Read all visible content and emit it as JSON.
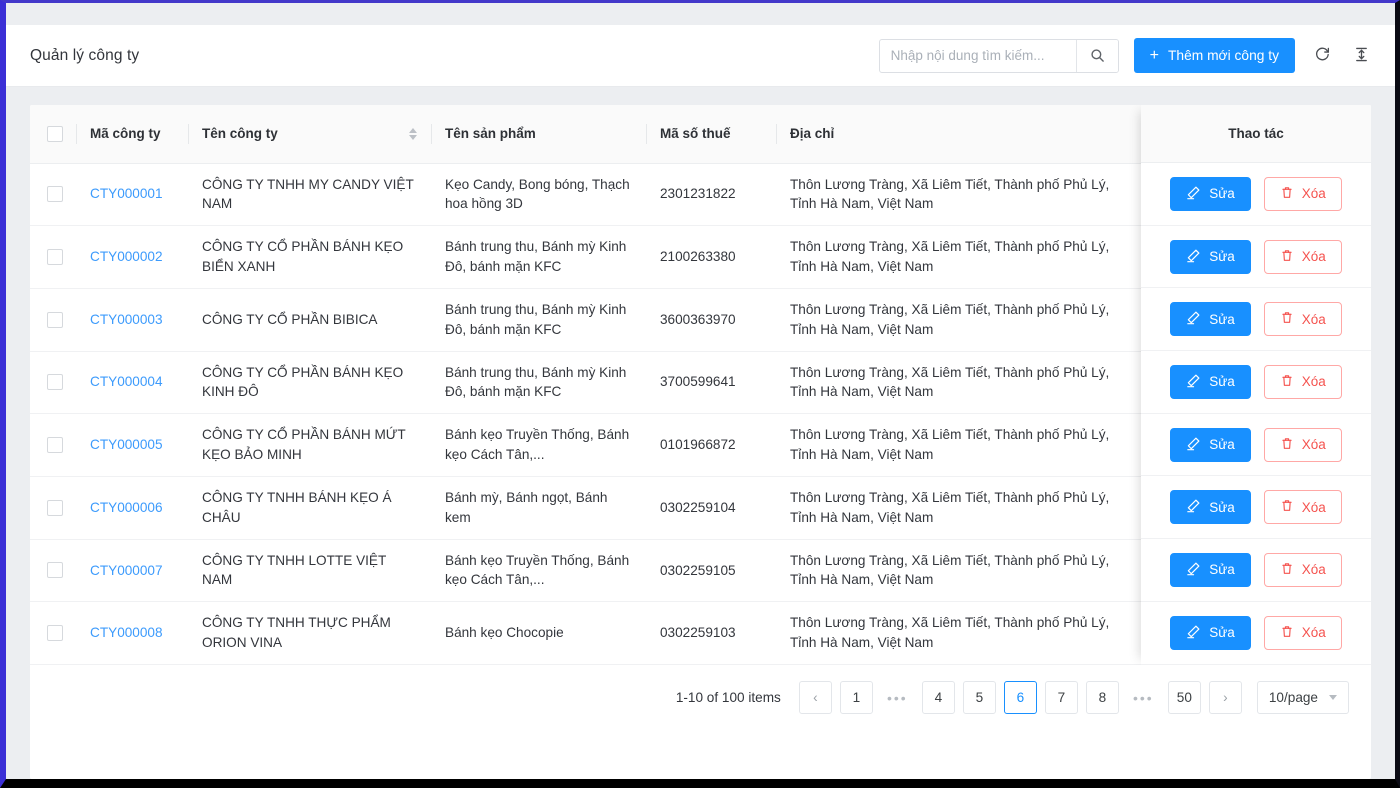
{
  "header": {
    "title": "Quản lý công ty",
    "search_placeholder": "Nhập nội dung tìm kiếm...",
    "search_value": "",
    "add_button": "Thêm mới công ty",
    "add_button_plus": "+",
    "reload_icon": "reload-icon",
    "column_height_icon": "column-height-icon",
    "search_icon": "search-icon",
    "accent_color": "#1890ff"
  },
  "table": {
    "columns": [
      {
        "key": "checkbox",
        "label": ""
      },
      {
        "key": "code",
        "label": "Mã công ty"
      },
      {
        "key": "name",
        "label": "Tên công ty",
        "sortable": true
      },
      {
        "key": "product",
        "label": "Tên sản phẩm"
      },
      {
        "key": "tax",
        "label": "Mã số thuế"
      },
      {
        "key": "address",
        "label": "Địa chỉ"
      }
    ],
    "action_column_label": "Thao tác",
    "edit_label": "Sửa",
    "delete_label": "Xóa",
    "edit_icon": "pencil-icon",
    "delete_icon": "trash-icon",
    "rows": [
      {
        "code": "CTY000001",
        "name": "CÔNG TY TNHH MY CANDY VIỆT NAM",
        "product": "Kẹo Candy, Bong bóng, Thạch hoa hồng 3D",
        "tax": "2301231822",
        "address": "Thôn Lương Tràng, Xã Liêm Tiết, Thành phố Phủ Lý, Tỉnh Hà Nam, Việt Nam"
      },
      {
        "code": "CTY000002",
        "name": "CÔNG TY CỔ PHẦN BÁNH KẸO BIỂN XANH",
        "product": "Bánh trung thu, Bánh mỳ Kinh Đô, bánh mặn KFC",
        "tax": "2100263380",
        "address": "Thôn Lương Tràng, Xã Liêm Tiết, Thành phố Phủ Lý, Tỉnh Hà Nam, Việt Nam"
      },
      {
        "code": "CTY000003",
        "name": "CÔNG TY CỔ PHẦN BIBICA",
        "product": "Bánh trung thu, Bánh mỳ Kinh Đô, bánh mặn KFC",
        "tax": "3600363970",
        "address": "Thôn Lương Tràng, Xã Liêm Tiết, Thành phố Phủ Lý, Tỉnh Hà Nam, Việt Nam"
      },
      {
        "code": "CTY000004",
        "name": "CÔNG TY CỔ PHẦN BÁNH KẸO KINH ĐÔ",
        "product": "Bánh trung thu, Bánh mỳ Kinh Đô, bánh mặn KFC",
        "tax": "3700599641",
        "address": "Thôn Lương Tràng, Xã Liêm Tiết, Thành phố Phủ Lý, Tỉnh Hà Nam, Việt Nam"
      },
      {
        "code": "CTY000005",
        "name": "CÔNG TY CỔ PHẦN BÁNH MỨT KẸO BẢO MINH",
        "product": "Bánh kẹo Truyền Thống, Bánh kẹo Cách Tân,...",
        "tax": "0101966872",
        "address": "Thôn Lương Tràng, Xã Liêm Tiết, Thành phố Phủ Lý, Tỉnh Hà Nam, Việt Nam"
      },
      {
        "code": "CTY000006",
        "name": "CÔNG TY TNHH BÁNH KẸO Á CHÂU",
        "product": "Bánh mỳ, Bánh ngọt, Bánh kem",
        "tax": "0302259104",
        "address": "Thôn Lương Tràng, Xã Liêm Tiết, Thành phố Phủ Lý, Tỉnh Hà Nam, Việt Nam"
      },
      {
        "code": "CTY000007",
        "name": "CÔNG TY TNHH LOTTE VIỆT NAM",
        "product": "Bánh kẹo Truyền Thống, Bánh kẹo Cách Tân,...",
        "tax": "0302259105",
        "address": "Thôn Lương Tràng, Xã Liêm Tiết, Thành phố Phủ Lý, Tỉnh Hà Nam, Việt Nam"
      },
      {
        "code": "CTY000008",
        "name": "CÔNG TY TNHH THỰC PHẨM ORION VINA",
        "product": "Bánh kẹo Chocopie",
        "tax": "0302259103",
        "address": "Thôn Lương Tràng, Xã Liêm Tiết, Thành phố Phủ Lý, Tỉnh Hà Nam, Việt Nam"
      }
    ]
  },
  "pagination": {
    "total_text": "1-10 of 100 items",
    "prev": "‹",
    "next": "›",
    "ellipsis": "•••",
    "items": [
      {
        "label": "1",
        "type": "page"
      },
      {
        "label": "•••",
        "type": "ellipsis"
      },
      {
        "label": "4",
        "type": "page"
      },
      {
        "label": "5",
        "type": "page"
      },
      {
        "label": "6",
        "type": "page",
        "active": true
      },
      {
        "label": "7",
        "type": "page"
      },
      {
        "label": "8",
        "type": "page"
      },
      {
        "label": "•••",
        "type": "ellipsis"
      },
      {
        "label": "50",
        "type": "page"
      }
    ],
    "page_size": "10/page"
  }
}
